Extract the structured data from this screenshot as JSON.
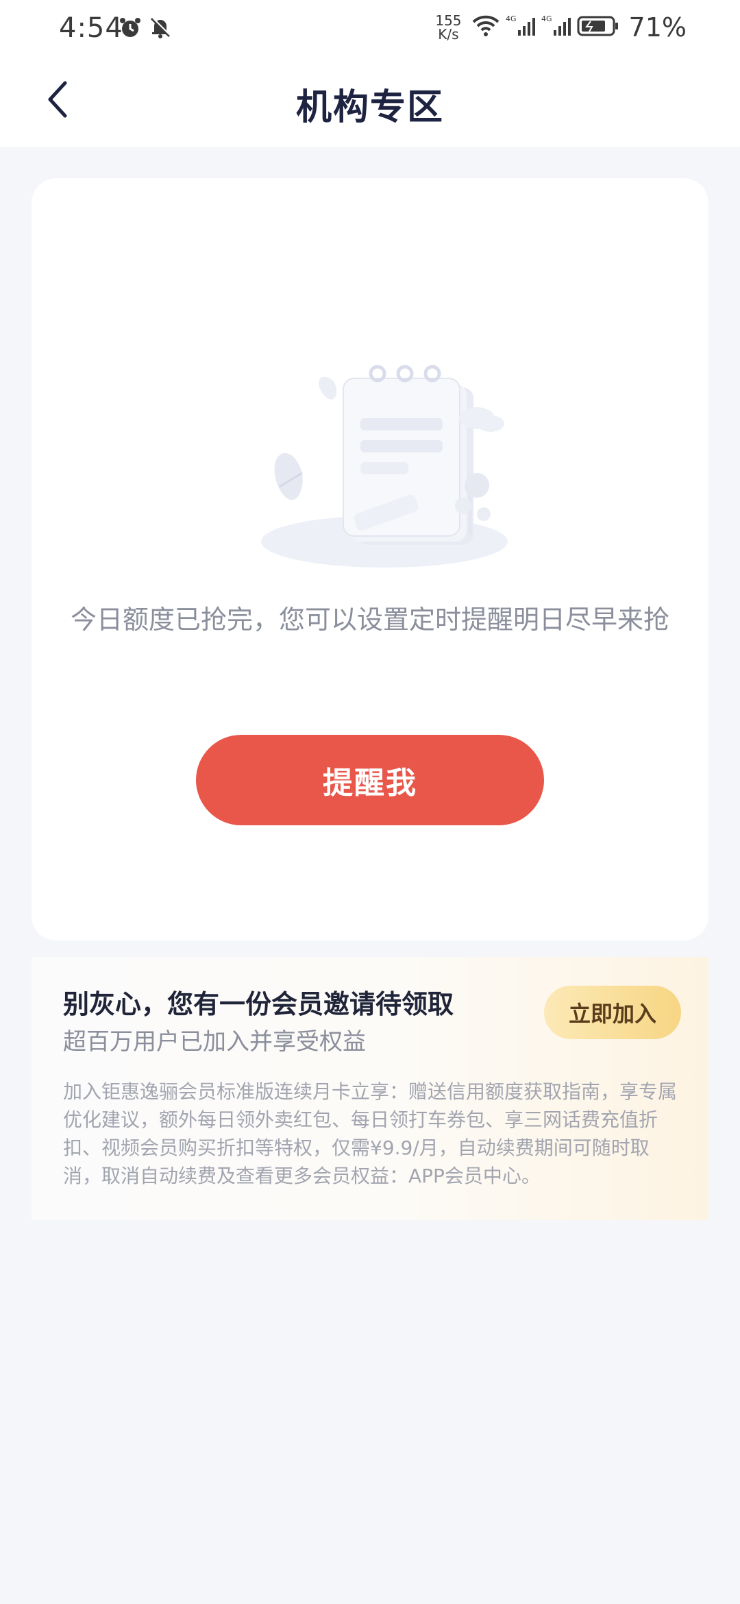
{
  "status_bar": {
    "time": "4:54",
    "net_speed_value": "155",
    "net_speed_unit": "K/s",
    "battery": "71%",
    "icons": [
      "alarm-icon",
      "mute-bell-icon",
      "wifi-icon",
      "signal-4g-icon",
      "signal-4g-icon",
      "battery-icon"
    ]
  },
  "header": {
    "title": "机构专区",
    "back_icon": "chevron-left-icon"
  },
  "main_card": {
    "illustration_icon": "empty-notepad-illustration",
    "message": "今日额度已抢完，您可以设置定时提醒明日尽早来抢",
    "remind_button": "提醒我",
    "accent_color": "#e8574a"
  },
  "member_card": {
    "title": "别灰心，您有一份会员邀请待领取",
    "subtitle": "超百万用户已加入并享受权益",
    "join_button": "立即加入",
    "description": "加入钜惠逸骊会员标准版连续月卡立享：赠送信用额度获取指南，享专属优化建议，额外每日领外卖红包、每日领打车券包、享三网话费充值折扣、视频会员购买折扣等特权，仅需¥9.9/月，自动续费期间可随时取消，取消自动续费及查看更多会员权益：APP会员中心。"
  }
}
